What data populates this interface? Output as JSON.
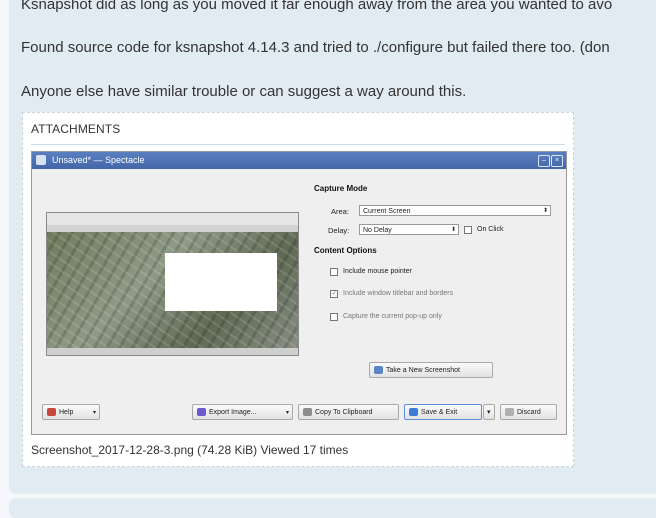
{
  "post": {
    "paragraphs": [
      "Ksnapshot did as long as you moved it far enough away from the area you wanted to avo",
      "Found source code for ksnapshot 4.14.3 and tried to ./configure but failed there too. (don",
      "Anyone else have similar trouble or can suggest a way around this."
    ]
  },
  "attachments": {
    "heading": "ATTACHMENTS",
    "caption": "Screenshot_2017-12-28-3.png (74.28 KiB) Viewed 17 times",
    "screenshot": {
      "window_title": "Unsaved* — Spectacle",
      "capture_mode_heading": "Capture Mode",
      "area_label": "Area:",
      "area_value": "Current Screen",
      "delay_label": "Delay:",
      "delay_value": "No Delay",
      "on_click_label": "On Click",
      "content_options_heading": "Content Options",
      "options": [
        {
          "label": "Include mouse pointer",
          "checked": false,
          "dim": false
        },
        {
          "label": "Include window titlebar and borders",
          "checked": true,
          "dim": true
        },
        {
          "label": "Capture the current pop-up only",
          "checked": false,
          "dim": true
        }
      ],
      "take_button": "Take a New Screenshot",
      "help_button": "Help",
      "export_button": "Export Image...",
      "copy_button": "Copy To Clipboard",
      "save_button": "Save & Exit",
      "discard_button": "Discard"
    }
  },
  "colors": {
    "post_bg": "#e1ebf2",
    "page_bg": "#f5f7fa",
    "text": "#333333",
    "titlebar": "#4466a8"
  }
}
